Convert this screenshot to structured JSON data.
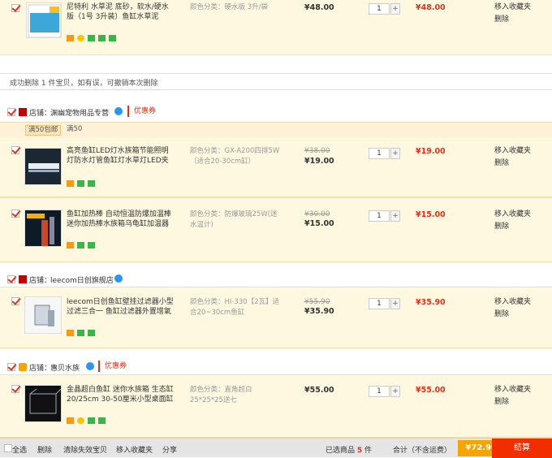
{
  "items": [
    {
      "title": "尼特利 水草泥 底砂，软水/硬水版（1号 3升装）鱼缸水草泥",
      "sku": "颜色分类：硬水版 3升/袋",
      "orig_price": "",
      "price": "¥48.00",
      "qty": "1",
      "qty_plus": "+",
      "sum": "¥48.00",
      "op_fav": "移入收藏夹",
      "op_del": "删除"
    },
    {
      "title": "高亮鱼缸LED灯水族箱节能照明灯防水灯管鱼缸灯水草灯LED夹灯",
      "sku": "颜色分类：GX-A200四排5W（适合20-30cm缸）",
      "orig_price": "¥38.00",
      "price": "¥19.00",
      "qty": "1",
      "qty_plus": "+",
      "sum": "¥19.00",
      "op_fav": "移入收藏夹",
      "op_del": "删除"
    },
    {
      "title": "鱼缸加热棒 自动恒温防爆加温棒迷你加热棒水族箱乌龟缸加温器",
      "sku": "颜色分类：防爆玻璃25W(迷水温计)",
      "orig_price": "¥30.00",
      "price": "¥15.00",
      "qty": "1",
      "qty_plus": "+",
      "sum": "¥15.00",
      "op_fav": "移入收藏夹",
      "op_del": "删除"
    },
    {
      "title": "leecom日创鱼缸壁挂过滤器小型过滤三合一 鱼缸过滤器外置增氧泵",
      "sku": "颜色分类：HI-330【2瓦】适合20~30cm鱼缸",
      "orig_price": "¥55.90",
      "price": "¥35.90",
      "qty": "1",
      "qty_plus": "+",
      "sum": "¥35.90",
      "op_fav": "移入收藏夹",
      "op_del": "删除"
    },
    {
      "title": "金晶超白鱼缸 迷你水族箱 生态缸20/25cm 30-50厘米小型桌面缸",
      "sku": "颜色分类：直角超白25*25*25送七",
      "orig_price": "",
      "price": "¥55.00",
      "qty": "1",
      "qty_plus": "+",
      "sum": "¥55.00",
      "op_fav": "移入收藏夹",
      "op_del": "删除"
    }
  ],
  "notice": "成功删除 1 件宝贝，如有误，可撤销本次删除",
  "shops": [
    {
      "label": "店铺：",
      "name": "渊幽宠物用品专营",
      "coupon": "优惠券"
    },
    {
      "label": "店铺：",
      "name": "leecom日创旗舰店",
      "coupon": ""
    },
    {
      "label": "店铺：",
      "name": "惠贝水族",
      "coupon": "优惠券"
    }
  ],
  "promo": {
    "tag1": "满50包邮",
    "tag2": "满50"
  },
  "footer": {
    "select_all": "全选",
    "delete": "删除",
    "clear_invalid": "清除失效宝贝",
    "move_fav": "移入收藏夹",
    "share": "分享",
    "selected_prefix": "已选商品",
    "selected_count": "5",
    "selected_suffix": "件",
    "total_label": "合计（不含运费）",
    "total": "¥72.90",
    "checkout": "结算"
  },
  "colors": {
    "accent": "#e0321a",
    "row_bg": "#fff8e1",
    "checkout": "#f22e00"
  }
}
